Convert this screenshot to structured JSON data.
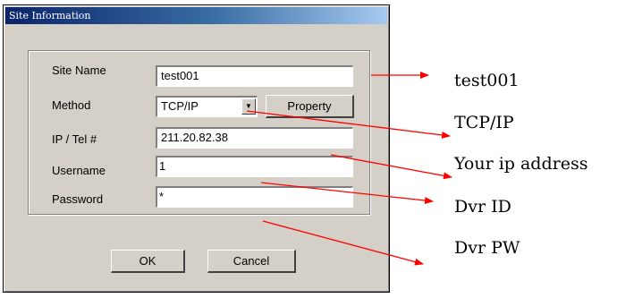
{
  "dialog": {
    "title": "Site Information",
    "fields": {
      "site_name": {
        "label": "Site Name",
        "value": "test001"
      },
      "method": {
        "label": "Method",
        "value": "TCP/IP"
      },
      "ip": {
        "label": "IP / Tel #",
        "value": "211.20.82.38"
      },
      "username": {
        "label": "Username",
        "value": "1"
      },
      "password": {
        "label": "Password",
        "value": "*"
      }
    },
    "property_label": "Property",
    "ok_label": "OK",
    "cancel_label": "Cancel"
  },
  "annotations": {
    "site_name": "test001",
    "method": "TCP/IP",
    "ip": "Your ip address",
    "username": "Dvr ID",
    "password": "Dvr PW"
  },
  "colors": {
    "arrow": "#ff0000",
    "dialog_face": "#d4d0c8",
    "titlebar": "#0a246a"
  }
}
